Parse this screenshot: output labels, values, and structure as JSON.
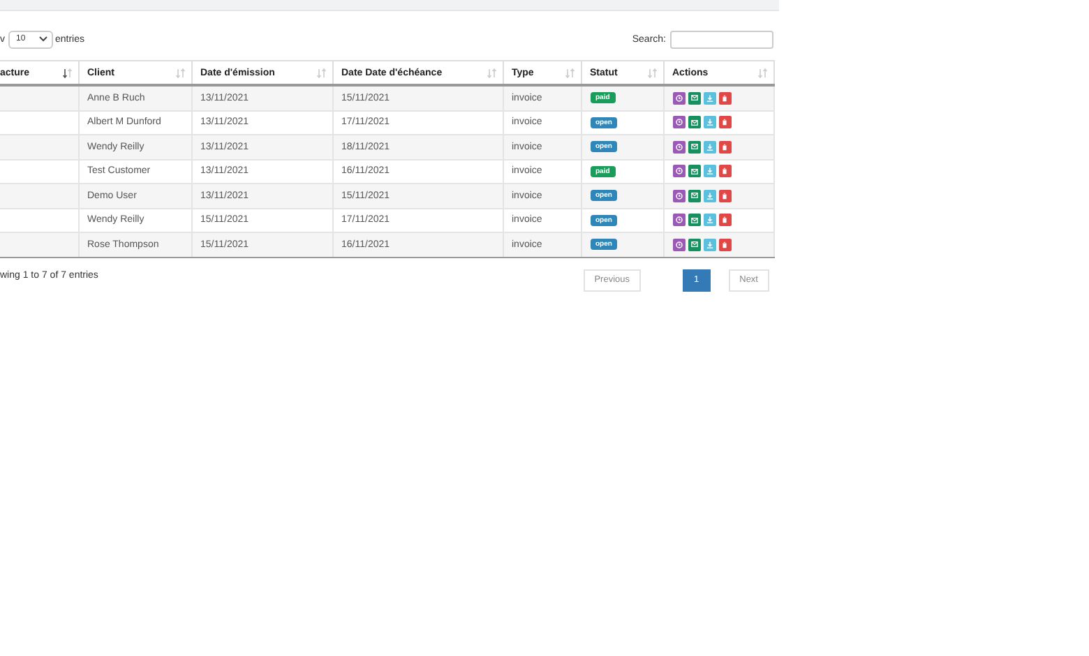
{
  "length_control": {
    "prefix": "v",
    "value": "10",
    "suffix": "entries"
  },
  "search": {
    "label": "Search:"
  },
  "table": {
    "columns": [
      {
        "label": "acture",
        "sorted": true
      },
      {
        "label": "Client",
        "sorted": false
      },
      {
        "label": "Date d'émission",
        "sorted": false
      },
      {
        "label": "Date Date d'échéance",
        "sorted": false
      },
      {
        "label": "Type",
        "sorted": false
      },
      {
        "label": "Statut",
        "sorted": false
      },
      {
        "label": "Actions",
        "sorted": false
      }
    ],
    "rows": [
      {
        "client": "Anne B Ruch",
        "issued": "13/11/2021",
        "due": "15/11/2021",
        "type": "invoice",
        "status": {
          "label": "paid",
          "kind": "paid"
        }
      },
      {
        "client": "Albert M Dunford",
        "issued": "13/11/2021",
        "due": "17/11/2021",
        "type": "invoice",
        "status": {
          "label": "open",
          "kind": "open"
        }
      },
      {
        "client": "Wendy Reilly",
        "issued": "13/11/2021",
        "due": "18/11/2021",
        "type": "invoice",
        "status": {
          "label": "open",
          "kind": "open"
        }
      },
      {
        "client": "Test Customer",
        "issued": "13/11/2021",
        "due": "16/11/2021",
        "type": "invoice",
        "status": {
          "label": "paid",
          "kind": "paid"
        }
      },
      {
        "client": "Demo User",
        "issued": "13/11/2021",
        "due": "15/11/2021",
        "type": "invoice",
        "status": {
          "label": "open",
          "kind": "open"
        }
      },
      {
        "client": "Wendy Reilly",
        "issued": "15/11/2021",
        "due": "17/11/2021",
        "type": "invoice",
        "status": {
          "label": "open",
          "kind": "open"
        }
      },
      {
        "client": "Rose Thompson",
        "issued": "15/11/2021",
        "due": "16/11/2021",
        "type": "invoice",
        "status": {
          "label": "open",
          "kind": "open"
        }
      }
    ]
  },
  "info": "wing 1 to 7 of 7 entries",
  "pagination": [
    {
      "label": "Previous",
      "kind": "prev",
      "selected": false
    },
    {
      "label": "1",
      "kind": "page",
      "selected": true
    },
    {
      "label": "Next",
      "kind": "next",
      "selected": false
    }
  ]
}
